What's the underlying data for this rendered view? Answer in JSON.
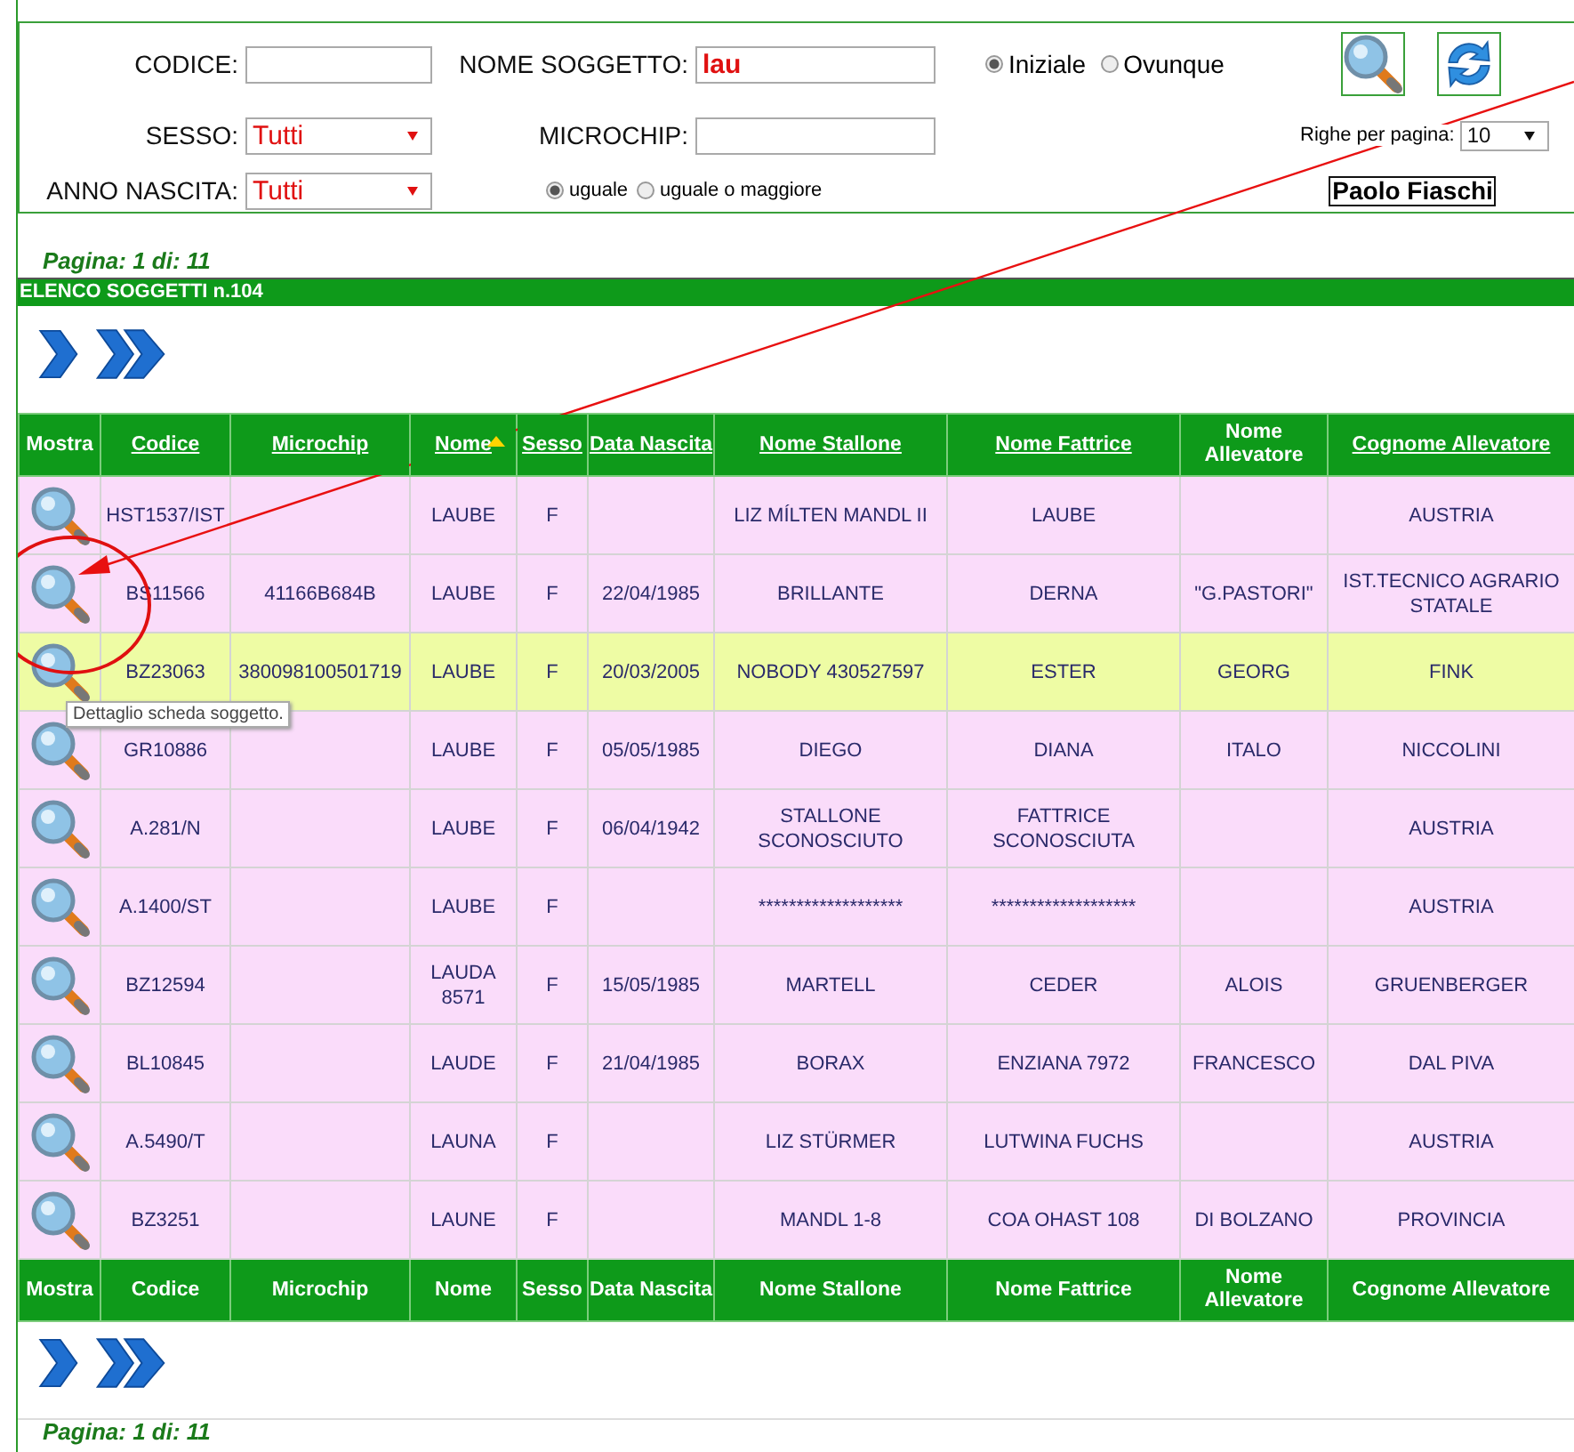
{
  "filters": {
    "codice": {
      "label": "CODICE:"
    },
    "nome": {
      "label": "NOME SOGGETTO:",
      "value": "lau"
    },
    "match_options": [
      {
        "label": "Iniziale",
        "selected": true
      },
      {
        "label": "Ovunque",
        "selected": false
      }
    ],
    "sesso": {
      "label": "SESSO:",
      "value": "Tutti"
    },
    "microchip": {
      "label": "MICROCHIP:"
    },
    "rows_per_page": {
      "label": "Righe per pagina:",
      "value": "10"
    },
    "anno": {
      "label": "ANNO NASCITA:",
      "value": "Tutti"
    },
    "year_options": [
      {
        "label": "uguale",
        "selected": true
      },
      {
        "label": "uguale o maggiore",
        "selected": false
      }
    ],
    "user": "Paolo Fiaschi"
  },
  "page_info_top": "Pagina: 1 di: 11",
  "list_title": "ELENCO SOGGETTI n.104",
  "columns": [
    {
      "label": "Mostra",
      "sortable": false,
      "sorted": false
    },
    {
      "label": "Codice",
      "sortable": true,
      "sorted": false
    },
    {
      "label": "Microchip",
      "sortable": true,
      "sorted": false
    },
    {
      "label": "Nome",
      "sortable": true,
      "sorted": true
    },
    {
      "label": "Sesso",
      "sortable": true,
      "sorted": false
    },
    {
      "label": "Data Nascita",
      "sortable": true,
      "sorted": false
    },
    {
      "label": "Nome Stallone",
      "sortable": true,
      "sorted": false
    },
    {
      "label": "Nome Fattrice",
      "sortable": true,
      "sorted": false
    },
    {
      "label": "Nome Allevatore",
      "sortable": false,
      "sorted": false
    },
    {
      "label": "Cognome Allevatore",
      "sortable": true,
      "sorted": false
    }
  ],
  "rows": [
    {
      "highlighted": false,
      "cells": [
        "HST1537/IST",
        "",
        "LAUBE",
        "F",
        "",
        "LIZ MÍLTEN MANDL II",
        "LAUBE",
        "",
        "AUSTRIA"
      ]
    },
    {
      "highlighted": false,
      "cells": [
        "BS11566",
        "41166B684B",
        "LAUBE",
        "F",
        "22/04/1985",
        "BRILLANTE",
        "DERNA",
        "\"G.PASTORI\"",
        "IST.TECNICO AGRARIO STATALE"
      ]
    },
    {
      "highlighted": true,
      "cells": [
        "BZ23063",
        "380098100501719",
        "LAUBE",
        "F",
        "20/03/2005",
        "NOBODY 430527597",
        "ESTER",
        "GEORG",
        "FINK"
      ]
    },
    {
      "highlighted": false,
      "cells": [
        "GR10886",
        "",
        "LAUBE",
        "F",
        "05/05/1985",
        "DIEGO",
        "DIANA",
        "ITALO",
        "NICCOLINI"
      ]
    },
    {
      "highlighted": false,
      "cells": [
        "A.281/N",
        "",
        "LAUBE",
        "F",
        "06/04/1942",
        "STALLONE SCONOSCIUTO",
        "FATTRICE SCONOSCIUTA",
        "",
        "AUSTRIA"
      ]
    },
    {
      "highlighted": false,
      "cells": [
        "A.1400/ST",
        "",
        "LAUBE",
        "F",
        "",
        "*******************",
        "*******************",
        "",
        "AUSTRIA"
      ]
    },
    {
      "highlighted": false,
      "cells": [
        "BZ12594",
        "",
        "LAUDA 8571",
        "F",
        "15/05/1985",
        "MARTELL",
        "CEDER",
        "ALOIS",
        "GRUENBERGER"
      ]
    },
    {
      "highlighted": false,
      "cells": [
        "BL10845",
        "",
        "LAUDE",
        "F",
        "21/04/1985",
        "BORAX",
        "ENZIANA 7972",
        "FRANCESCO",
        "DAL PIVA"
      ]
    },
    {
      "highlighted": false,
      "cells": [
        "A.5490/T",
        "",
        "LAUNA",
        "F",
        "",
        "LIZ STÜRMER",
        "LUTWINA FUCHS",
        "",
        "AUSTRIA"
      ]
    },
    {
      "highlighted": false,
      "cells": [
        "BZ3251",
        "",
        "LAUNE",
        "F",
        "",
        "MANDL 1-8",
        "COA OHAST 108",
        "DI BOLZANO",
        "PROVINCIA"
      ]
    }
  ],
  "footer_columns": [
    "Mostra",
    "Codice",
    "Microchip",
    "Nome",
    "Sesso",
    "Data Nascita",
    "Nome Stallone",
    "Nome Fattrice",
    "Nome Allevatore",
    "Cognome Allevatore"
  ],
  "tooltip": "Dettaglio scheda soggetto.",
  "page_info_bottom": "Pagina: 1 di: 11"
}
